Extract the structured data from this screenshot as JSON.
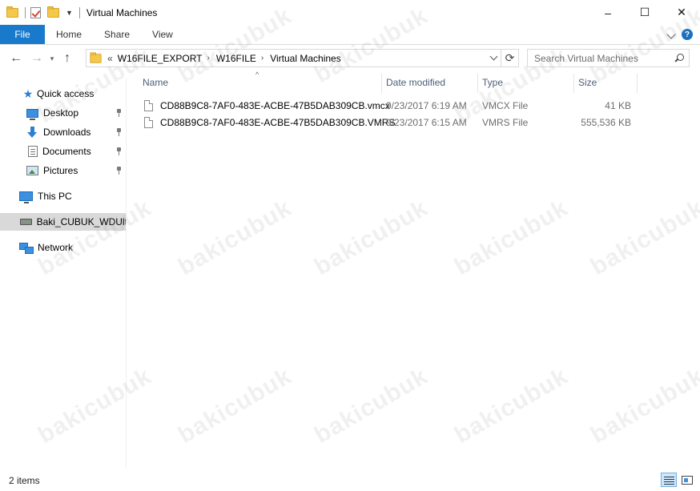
{
  "window": {
    "title": "Virtual Machines",
    "controls": [
      "–",
      "☐",
      "✕"
    ]
  },
  "ribbon": {
    "file": "File",
    "tabs": [
      "Home",
      "Share",
      "View"
    ]
  },
  "address": {
    "prefix": "«",
    "crumbs": [
      "W16FILE_EXPORT",
      "W16FILE",
      "Virtual Machines"
    ]
  },
  "search": {
    "placeholder": "Search Virtual Machines"
  },
  "nav": {
    "quick_access": "Quick access",
    "desktop": "Desktop",
    "downloads": "Downloads",
    "documents": "Documents",
    "pictures": "Pictures",
    "this_pc": "This PC",
    "drive": "Baki_CUBUK_WDUltra",
    "network": "Network"
  },
  "columns": {
    "name": "Name",
    "date": "Date modified",
    "type": "Type",
    "size": "Size"
  },
  "files": [
    {
      "name": "CD88B9C8-7AF0-483E-ACBE-47B5DAB309CB.vmcx",
      "date": "9/23/2017 6:19 AM",
      "type": "VMCX File",
      "size": "41 KB"
    },
    {
      "name": "CD88B9C8-7AF0-483E-ACBE-47B5DAB309CB.VMRS",
      "date": "9/23/2017 6:15 AM",
      "type": "VMRS File",
      "size": "555,536 KB"
    }
  ],
  "status": {
    "count": "2 items"
  },
  "watermark": "bakicubuk"
}
